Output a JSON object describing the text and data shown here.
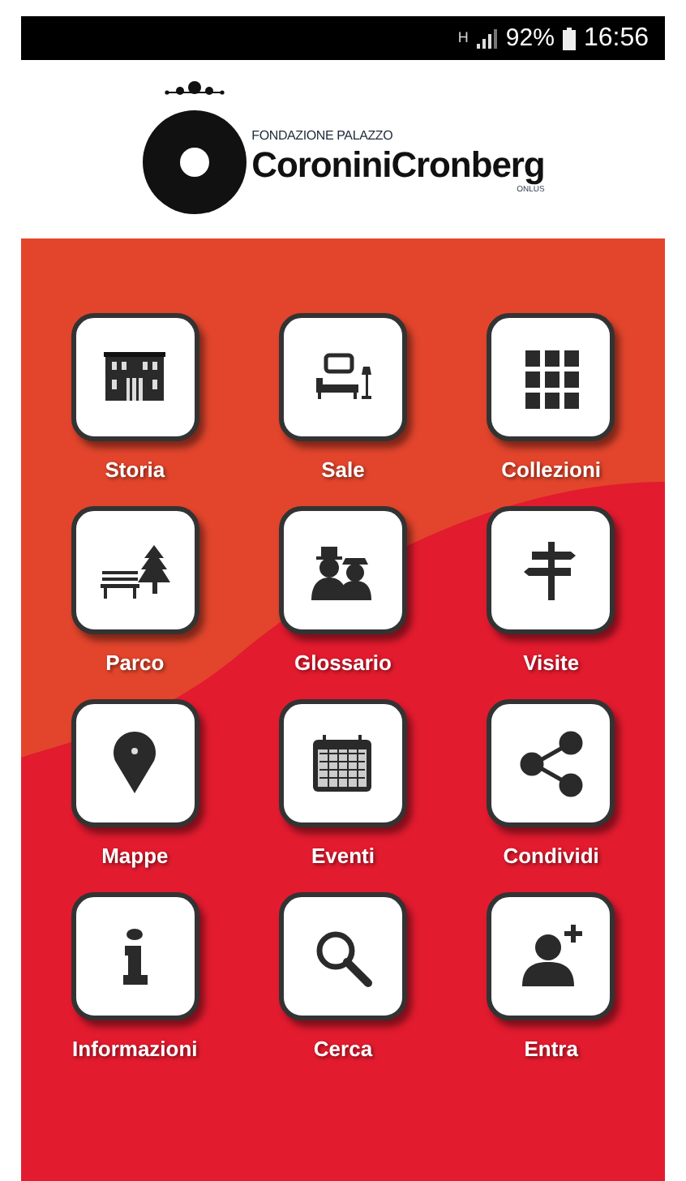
{
  "status_bar": {
    "network": "H",
    "battery": "92%",
    "time": "16:56"
  },
  "logo": {
    "subtitle": "FONDAZIONE PALAZZO",
    "name": "CoroniniCronberg",
    "suffix": "ONLUS"
  },
  "menu": [
    {
      "label": "Storia",
      "kind": "building"
    },
    {
      "label": "Sale",
      "kind": "room"
    },
    {
      "label": "Collezioni",
      "kind": "grid"
    },
    {
      "label": "Parco",
      "kind": "park"
    },
    {
      "label": "Glossario",
      "kind": "people"
    },
    {
      "label": "Visite",
      "kind": "signpost"
    },
    {
      "label": "Mappe",
      "kind": "pin"
    },
    {
      "label": "Eventi",
      "kind": "calendar"
    },
    {
      "label": "Condividi",
      "kind": "share"
    },
    {
      "label": "Informazioni",
      "kind": "info"
    },
    {
      "label": "Cerca",
      "kind": "search"
    },
    {
      "label": "Entra",
      "kind": "user"
    }
  ]
}
